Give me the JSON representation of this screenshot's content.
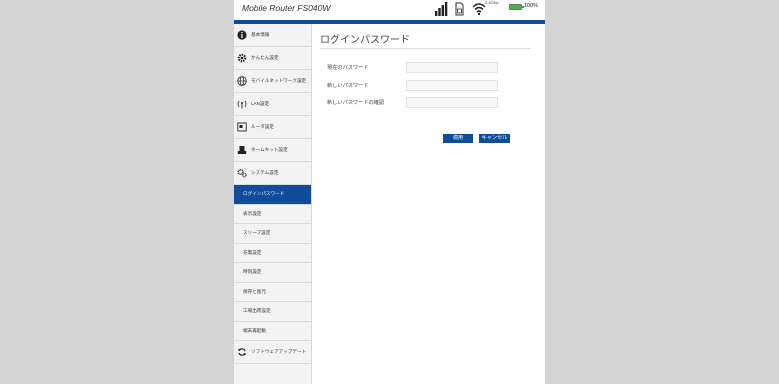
{
  "header": {
    "title": "Mobile Router FS040W",
    "wifi_band": "2.4GHz",
    "battery_level": "100%",
    "battery_fraction": 1.0
  },
  "sidebar": {
    "items": [
      {
        "label": "基本情報",
        "icon": "info-icon"
      },
      {
        "label": "かんたん設定",
        "icon": "gear-icon"
      },
      {
        "label": "モバイルネットワーク設定",
        "icon": "globe-icon"
      },
      {
        "label": "LAN設定",
        "icon": "wifi-antenna-icon"
      },
      {
        "label": "ルータ設定",
        "icon": "router-icon"
      },
      {
        "label": "ホームキット設定",
        "icon": "cradle-icon"
      },
      {
        "label": "システム設定",
        "icon": "gears-icon"
      }
    ],
    "subitems": [
      {
        "label": "ログインパスワード",
        "active": true
      },
      {
        "label": "表示設定"
      },
      {
        "label": "スリープ設定"
      },
      {
        "label": "充電設定"
      },
      {
        "label": "時刻設定"
      },
      {
        "label": "保存と復元"
      },
      {
        "label": "工場出荷設定"
      },
      {
        "label": "端末再起動"
      }
    ],
    "bottom_item": {
      "label": "ソフトウェアアップデート",
      "icon": "refresh-icon"
    }
  },
  "main": {
    "title": "ログインパスワード",
    "fields": [
      {
        "label": "現在のパスワード",
        "value": ""
      },
      {
        "label": "新しいパスワード",
        "value": ""
      },
      {
        "label": "新しいパスワードの確認",
        "value": ""
      }
    ],
    "apply_label": "適用",
    "cancel_label": "キャンセル"
  },
  "colors": {
    "accent": "#0f4c9a",
    "battery": "#4caf50",
    "background": "#d4d4d4"
  }
}
